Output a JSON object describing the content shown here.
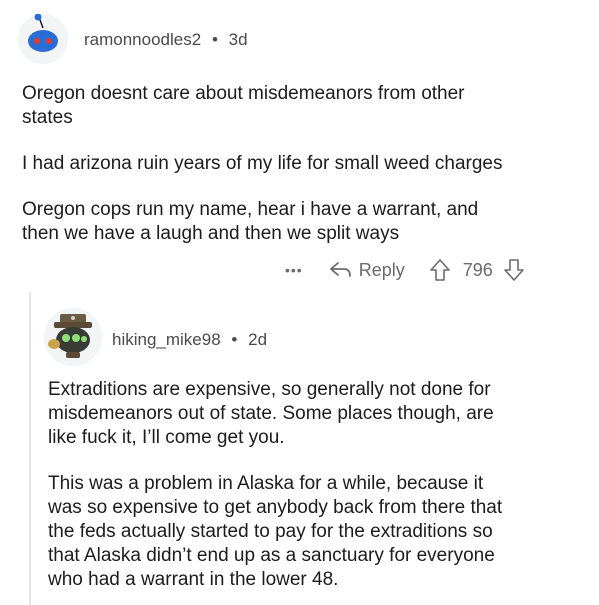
{
  "comment1": {
    "username": "ramonnoodles2",
    "age": "3d",
    "paragraphs": [
      [
        "Oregon doesnt care about misdemeanors from other",
        "states"
      ],
      [
        "I had arizona ruin years of my life for small weed charges"
      ],
      [
        "Oregon cops run my name, hear i have a warrant, and",
        "then we have a laugh and then we split ways"
      ]
    ],
    "more": "•••",
    "reply_label": "Reply",
    "votes": "796"
  },
  "comment2": {
    "username": "hiking_mike98",
    "age": "2d",
    "paragraphs": [
      [
        "Extraditions are expensive, so generally not done for",
        "misdemeanors out of state. Some places though, are",
        "like fuck it, I’ll come get you."
      ],
      [
        "This was a problem in Alaska for a while, because it",
        "was so expensive to get anybody back from there that",
        "the feds actually started to pay for the extraditions so",
        "that Alaska didn’t end up as a sanctuary for everyone",
        "who had a warrant in the lower 48."
      ]
    ]
  },
  "sep": "•",
  "colors": {
    "accent_blue": "#2a6dd6",
    "eye_red": "#e23b2e",
    "text": "#1c1c1c",
    "meta": "#6a6a6a"
  }
}
